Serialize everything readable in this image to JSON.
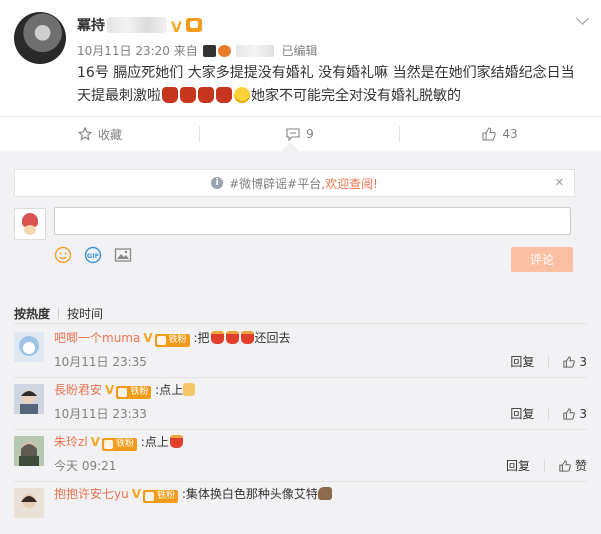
{
  "post": {
    "author": "冪持",
    "date": "10月11日 23:20",
    "source_prefix": "来自",
    "edited": "已编辑",
    "text_a": "16号  膈应死她们  大家多提提没有婚礼  没有婚礼嘛  当然是在她们家结婚纪念日当天提最刺激啦",
    "text_b": "她家不可能完全对没有婚礼脱敏的"
  },
  "actions": {
    "favorite": "收藏",
    "comments": "9",
    "likes": "43"
  },
  "notice": {
    "prefix": "#微博辟谣#平台,",
    "link": "欢迎查阅!"
  },
  "composer": {
    "placeholder": "",
    "submit": "评论"
  },
  "sort": {
    "hot": "按热度",
    "time": "按时间"
  },
  "comments": [
    {
      "nick": "吧唧一个muma",
      "fan": "铁粉",
      "text_pre": ":把",
      "text_post": "还回去",
      "time": "10月11日 23:35",
      "reply": "回复",
      "likes": "3"
    },
    {
      "nick": "長盼君安",
      "fan": "铁粉",
      "text_pre": ":点上",
      "text_post": "",
      "time": "10月11日 23:33",
      "reply": "回复",
      "likes": "3"
    },
    {
      "nick": "朱玲zl",
      "fan": "铁粉",
      "text_pre": ":点上",
      "text_post": "",
      "time": "今天 09:21",
      "reply": "回复",
      "likes": "赞"
    },
    {
      "nick": "抱抱许安七yu",
      "fan": "铁粉",
      "text_pre": ":集体换白色那种头像艾特",
      "text_post": "",
      "time": "",
      "reply": "",
      "likes": ""
    }
  ],
  "colors": {
    "accent": "#eb7350",
    "vip": "#f6a623",
    "button_disabled": "#fbbfa3",
    "background": "#f2f2f5"
  },
  "icons": [
    "more-chevron-icon",
    "star-icon",
    "comment-icon",
    "thumb-up-icon",
    "info-icon",
    "close-icon",
    "emoji-icon",
    "gif-icon",
    "image-icon"
  ]
}
